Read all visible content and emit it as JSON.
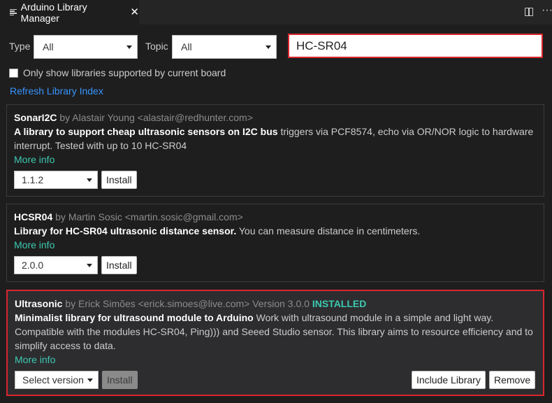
{
  "tab": {
    "title": "Arduino Library Manager",
    "close_glyph": "✕"
  },
  "toolbar": {
    "more_glyph": "···"
  },
  "filters": {
    "type_label": "Type",
    "type_value": "All",
    "topic_label": "Topic",
    "topic_value": "All",
    "search_value": "HC-SR04"
  },
  "board_filter": {
    "label": "Only show libraries supported by current board",
    "checked": false
  },
  "refresh_label": "Refresh Library Index",
  "libraries": [
    {
      "name": "SonarI2C",
      "by": "by",
      "author": "Alastair Young <alastair@redhunter.com>",
      "summary": "A library to support cheap ultrasonic sensors on I2C bus",
      "description": " triggers via PCF8574, echo via OR/NOR logic to hardware interrupt. Tested with up to 10 HC-SR04",
      "more_info": "More info",
      "version_select": "1.1.2",
      "install_label": "Install"
    },
    {
      "name": "HCSR04",
      "by": "by",
      "author": "Martin Sosic <martin.sosic@gmail.com>",
      "summary": "Library for HC-SR04 ultrasonic distance sensor.",
      "description": " You can measure distance in centimeters.",
      "more_info": "More info",
      "version_select": "2.0.0",
      "install_label": "Install"
    },
    {
      "name": "Ultrasonic",
      "by": "by",
      "author": "Erick Simões <erick.simoes@live.com>",
      "version": "Version 3.0.0",
      "status": "INSTALLED",
      "summary": "Minimalist library for ultrasound module to Arduino",
      "description": " Work with ultrasound module in a simple and light way. Compatible with the modules HC-SR04, Ping))) and Seeed Studio sensor. This library aims to resource efficiency and to simplify access to data.",
      "more_info": "More info",
      "version_select": "Select version",
      "install_label": "Install",
      "include_label": "Include Library",
      "remove_label": "Remove"
    }
  ],
  "colors": {
    "accent_link": "#3794ff",
    "installed": "#3dc9b0",
    "highlight_border": "#d9262e"
  }
}
